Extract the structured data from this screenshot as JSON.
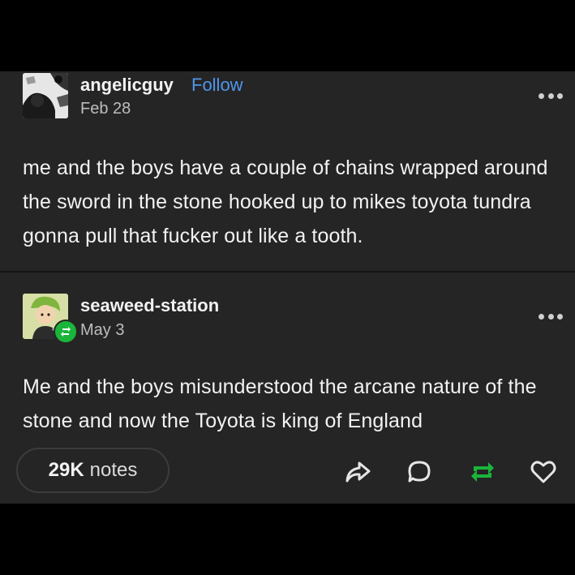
{
  "posts": [
    {
      "username": "angelicguy",
      "follow_label": "Follow",
      "date": "Feb 28",
      "text": "me and the boys have a couple of chains wrapped around the sword in the stone hooked up to mikes toyota tundra gonna pull that fucker out like a tooth."
    },
    {
      "username": "seaweed-station",
      "date": "May 3",
      "text": "Me and the boys misunderstood the arcane nature of the stone and now the Toyota is king of England"
    }
  ],
  "footer": {
    "notes_count": "29K",
    "notes_label": "notes",
    "actions": [
      "share-icon",
      "reply-icon",
      "reblog-icon",
      "like-icon"
    ]
  },
  "colors": {
    "background": "#000000",
    "card": "#252525",
    "text": "#f2f2f2",
    "muted": "#bdbdbd",
    "follow": "#4f96ec",
    "reblog": "#1ab53a"
  }
}
